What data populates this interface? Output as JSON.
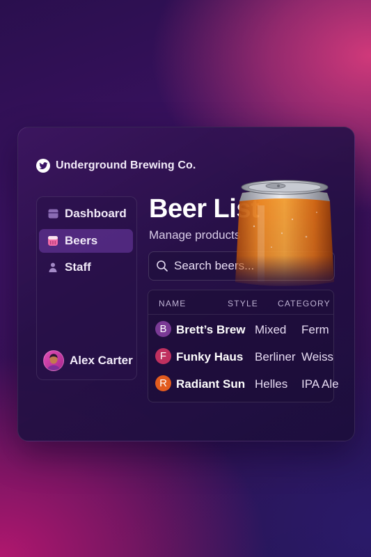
{
  "brand": {
    "name": "Underground Brewing Co.",
    "logo_icon": "bird-icon"
  },
  "sidebar": {
    "items": [
      {
        "label": "Dashboard",
        "icon": "dashboard-icon",
        "active": false
      },
      {
        "label": "Beers",
        "icon": "beer-mug-icon",
        "active": true
      },
      {
        "label": "Staff",
        "icon": "person-icon",
        "active": false
      }
    ],
    "user": {
      "name": "Alex Carter"
    }
  },
  "main": {
    "title": "Beer List",
    "subtitle": "Manage products",
    "search": {
      "placeholder": "Search beers...",
      "value": ""
    },
    "table": {
      "headers": [
        "NAME",
        "STYLE",
        "CATEGORY"
      ],
      "rows": [
        {
          "initial": "B",
          "name": "Brett’s Brew",
          "style": "Mixed",
          "category": "Ferm",
          "color": "#7a3a95"
        },
        {
          "initial": "F",
          "name": "Funky Haus",
          "style": "Berliner",
          "category": "Weiss",
          "color": "#c0305f"
        },
        {
          "initial": "R",
          "name": "Radiant Sun",
          "style": "Helles",
          "category": "IPA  Ale",
          "color": "#e25b1e"
        }
      ]
    }
  },
  "colors": {
    "accent": "#8046be",
    "background": "#3b1261",
    "highlight": "#d0397a"
  }
}
